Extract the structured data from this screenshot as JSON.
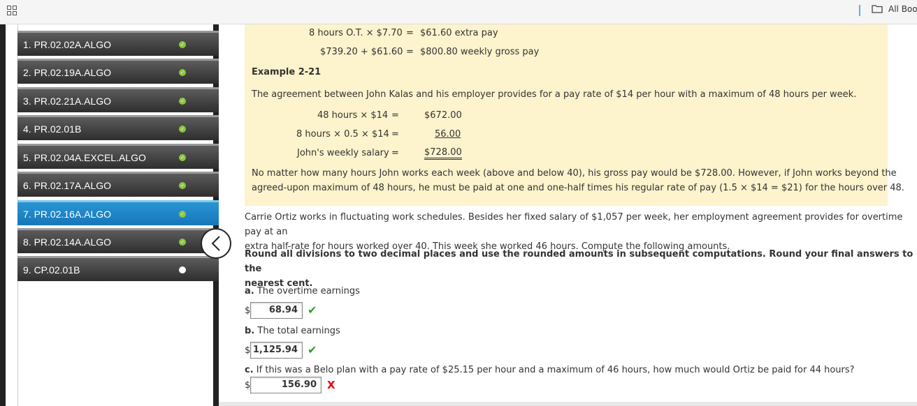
{
  "topbar": {
    "books_label": "All Books"
  },
  "sidebar": {
    "items": [
      {
        "label": "1. PR.02.02A.ALGO",
        "status": "complete"
      },
      {
        "label": "2. PR.02.19A.ALGO",
        "status": "complete"
      },
      {
        "label": "3. PR.02.21A.ALGO",
        "status": "complete"
      },
      {
        "label": "4. PR.02.01B",
        "status": "complete"
      },
      {
        "label": "5. PR.02.04A.EXCEL.ALGO",
        "status": "complete"
      },
      {
        "label": "6. PR.02.17A.ALGO",
        "status": "complete"
      },
      {
        "label": "7. PR.02.16A.ALGO",
        "status": "complete",
        "active": true
      },
      {
        "label": "8. PR.02.14A.ALGO",
        "status": "complete"
      },
      {
        "label": "9. CP.02.01B",
        "status": "incomplete"
      }
    ],
    "collapse_glyph": "<"
  },
  "example_prev": {
    "line1_left": "8 hours O.T. × $7.70",
    "line1_eq": "=",
    "line1_right": "$61.60 extra pay",
    "line2_left": "$739.20 + $61.60",
    "line2_eq": "=",
    "line2_right": "$800.80 weekly gross pay"
  },
  "example": {
    "title": "Example 2-21",
    "intro": "The agreement between John Kalas and his employer provides for a pay rate of $14 per hour with a maximum of 48 hours per week.",
    "rows": [
      {
        "left": "48 hours × $14",
        "eq": "=",
        "right": "$672.00"
      },
      {
        "left": "8 hours × 0.5 × $14",
        "eq": "=",
        "right": "56.00"
      },
      {
        "left": "John's weekly salary",
        "eq": "=",
        "right": "$728.00"
      }
    ],
    "note_line1": "No matter how many hours John works each week (above and below 40), his gross pay would be $728.00. However, if John works beyond the",
    "note_line2": "agreed-upon maximum of 48 hours, he must be paid at one and one-half times his regular rate of pay (1.5 × $14 = $21) for the hours over 48."
  },
  "problem": {
    "text_line1": "Carrie Ortiz works in fluctuating work schedules. Besides her fixed salary of $1,057 per week, her employment agreement provides for overtime pay at an",
    "text_line2": "extra half-rate for hours worked over 40. This week she worked 46 hours. Compute the following amounts.",
    "instr_line1": "Round all divisions to two decimal places and use the rounded amounts in subsequent computations. Round your final answers to the",
    "instr_line2": "nearest cent.",
    "currency": "$",
    "a": {
      "letter": "a.",
      "question": "The overtime earnings",
      "value": "68.94",
      "result": "✔"
    },
    "b": {
      "letter": "b.",
      "question": "The total earnings",
      "value": "1,125.94",
      "result": "✔"
    },
    "c": {
      "letter": "c.",
      "question": "If this was a Belo plan with a pay rate of $25.15 per hour and a maximum of 46 hours, how much would Ortiz be paid for 44 hours?",
      "value": "156.90",
      "result": "X"
    }
  }
}
